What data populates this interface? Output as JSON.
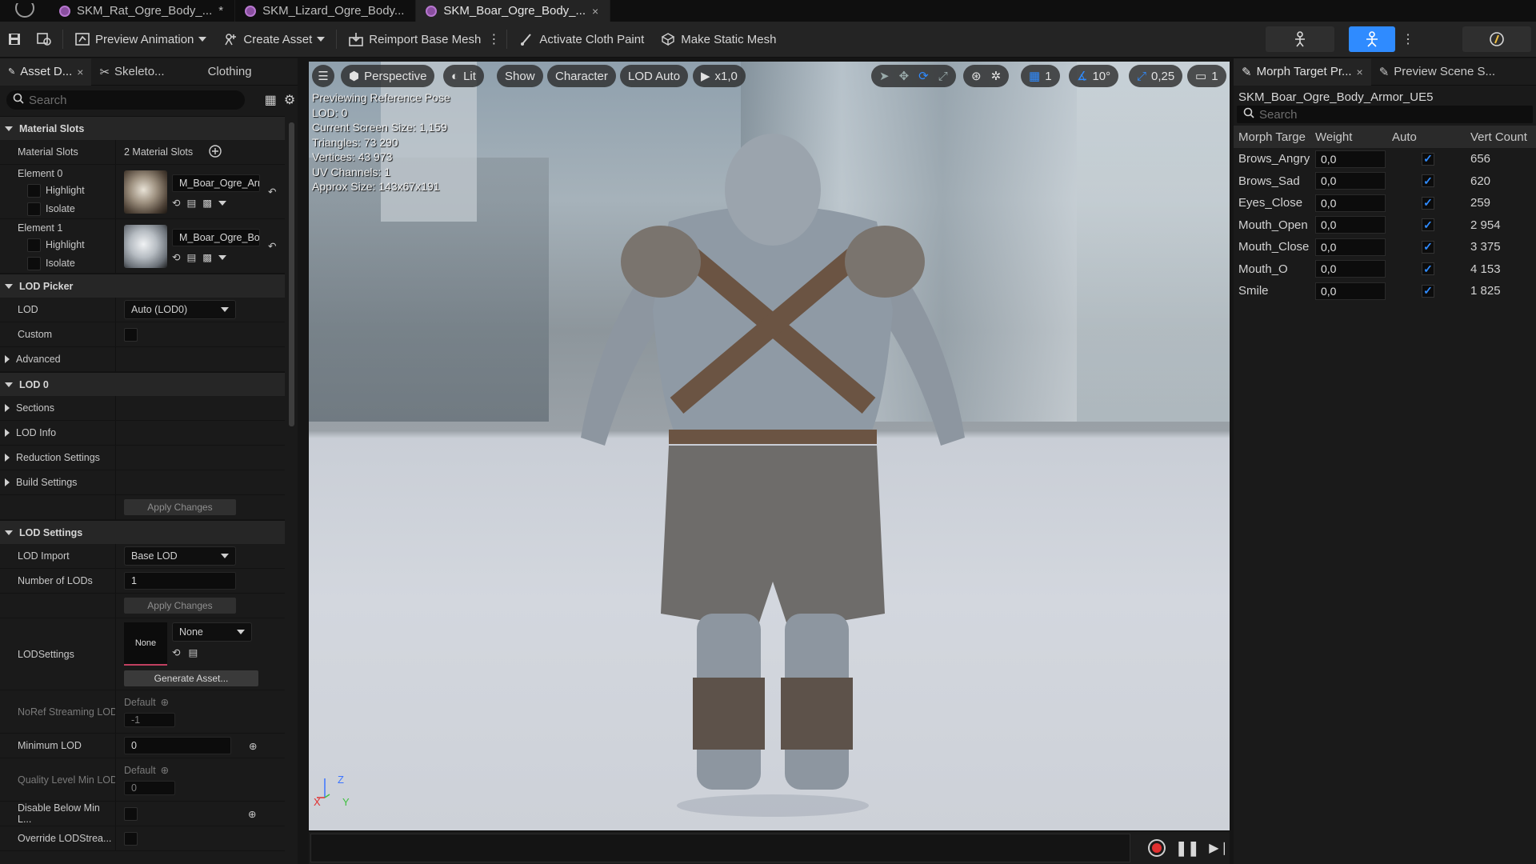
{
  "tabs": [
    {
      "label": "SKM_Rat_Ogre_Body_...",
      "suffix": "*"
    },
    {
      "label": "SKM_Lizard_Ogre_Body..."
    },
    {
      "label": "SKM_Boar_Ogre_Body_...",
      "close": "×"
    }
  ],
  "toolbar": {
    "preview_animation": "Preview Animation",
    "create_asset": "Create Asset",
    "reimport": "Reimport Base Mesh",
    "cloth_paint": "Activate Cloth Paint",
    "static_mesh": "Make Static Mesh"
  },
  "left_panel": {
    "tabs": [
      "Asset D...",
      "Skeleto...",
      "Clothing"
    ],
    "search_placeholder": "Search",
    "material_slots": {
      "section": "Material Slots",
      "label": "Material Slots",
      "count": "2 Material Slots",
      "elements": [
        {
          "label": "Element 0",
          "material": "M_Boar_Ogre_Arm",
          "highlight": "Highlight",
          "isolate": "Isolate"
        },
        {
          "label": "Element 1",
          "material": "M_Boar_Ogre_Bod",
          "highlight": "Highlight",
          "isolate": "Isolate"
        }
      ]
    },
    "lod_picker": {
      "section": "LOD Picker",
      "lod_label": "LOD",
      "lod_value": "Auto (LOD0)",
      "custom": "Custom",
      "advanced": "Advanced"
    },
    "lod0": {
      "section": "LOD 0",
      "items": [
        "Sections",
        "LOD Info",
        "Reduction Settings",
        "Build Settings"
      ],
      "apply": "Apply Changes"
    },
    "lod_settings": {
      "section": "LOD Settings",
      "lod_import_label": "LOD Import",
      "lod_import_value": "Base LOD",
      "num_lods_label": "Number of LODs",
      "num_lods_value": "1",
      "apply": "Apply Changes",
      "lodsettings_label": "LODSettings",
      "lodsettings_thumb": "None",
      "lodsettings_value": "None",
      "generate": "Generate Asset...",
      "noref_label": "NoRef Streaming LOD",
      "noref_default": "Default",
      "noref_value": "-1",
      "min_lod_label": "Minimum LOD",
      "min_lod_value": "0",
      "quality_label": "Quality Level Min LOD",
      "quality_default": "Default",
      "quality_value": "0",
      "disable_label": "Disable Below Min L...",
      "override_label": "Override LODStrea..."
    }
  },
  "viewport": {
    "perspective": "Perspective",
    "lit": "Lit",
    "show": "Show",
    "character": "Character",
    "lod": "LOD Auto",
    "speed": "x1,0",
    "grid": "1",
    "angle": "10°",
    "scale": "0,25",
    "camera": "1",
    "overlay": [
      "Previewing Reference Pose",
      "LOD: 0",
      "Current Screen Size: 1,159",
      "Triangles: 73 290",
      "Vertices: 43 973",
      "UV Channels: 1",
      "Approx Size: 143x67x191"
    ],
    "axis": {
      "z": "Z",
      "x": "X",
      "y": "Y"
    }
  },
  "right_panel": {
    "tabs": [
      "Morph Target Pr...",
      "Preview Scene S..."
    ],
    "asset_name": "SKM_Boar_Ogre_Body_Armor_UE5",
    "search_placeholder": "Search",
    "columns": [
      "Morph Targe",
      "Weight",
      "Auto",
      "Vert Count"
    ],
    "rows": [
      {
        "name": "Brows_Angry",
        "weight": "0,0",
        "auto": true,
        "verts": "656"
      },
      {
        "name": "Brows_Sad",
        "weight": "0,0",
        "auto": true,
        "verts": "620"
      },
      {
        "name": "Eyes_Close",
        "weight": "0,0",
        "auto": true,
        "verts": "259"
      },
      {
        "name": "Mouth_Open",
        "weight": "0,0",
        "auto": true,
        "verts": "2 954"
      },
      {
        "name": "Mouth_Close",
        "weight": "0,0",
        "auto": true,
        "verts": "3 375"
      },
      {
        "name": "Mouth_O",
        "weight": "0,0",
        "auto": true,
        "verts": "4 153"
      },
      {
        "name": "Smile",
        "weight": "0,0",
        "auto": true,
        "verts": "1 825"
      }
    ]
  },
  "colors": {
    "accent": "#2f8bff",
    "tab_icon": "#8a4fa0"
  }
}
